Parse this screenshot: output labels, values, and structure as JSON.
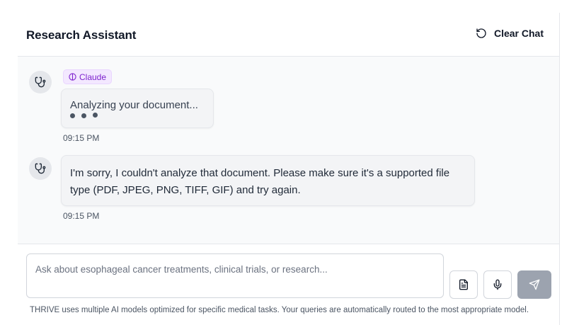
{
  "header": {
    "title": "Research Assistant",
    "clear_label": "Clear Chat",
    "clear_icon": "rotate-ccw-icon"
  },
  "messages": [
    {
      "sender_icon": "stethoscope-icon",
      "model_badge": "Claude",
      "model_badge_icon": "brain-icon",
      "text": "Analyzing your document...",
      "typing": true,
      "time": "09:15 PM"
    },
    {
      "sender_icon": "stethoscope-icon",
      "text": "I'm sorry, I couldn't analyze that document. Please make sure it's a supported file type (PDF, JPEG, PNG, TIFF, GIF) and try again.",
      "time": "09:15 PM"
    }
  ],
  "composer": {
    "placeholder": "Ask about esophageal cancer treatments, clinical trials, or research...",
    "value": "",
    "attach_icon": "file-text-icon",
    "mic_icon": "mic-icon",
    "send_icon": "send-icon",
    "disclaimer": "THRIVE uses multiple AI models optimized for specific medical tasks. Your queries are automatically routed to the most appropriate model."
  },
  "colors": {
    "badge_bg": "#f3e8ff",
    "badge_text": "#7e22ce",
    "send_bg": "#9ca3af",
    "bubble_bg": "#f3f4f6",
    "panel_bg": "#f9fafb"
  }
}
